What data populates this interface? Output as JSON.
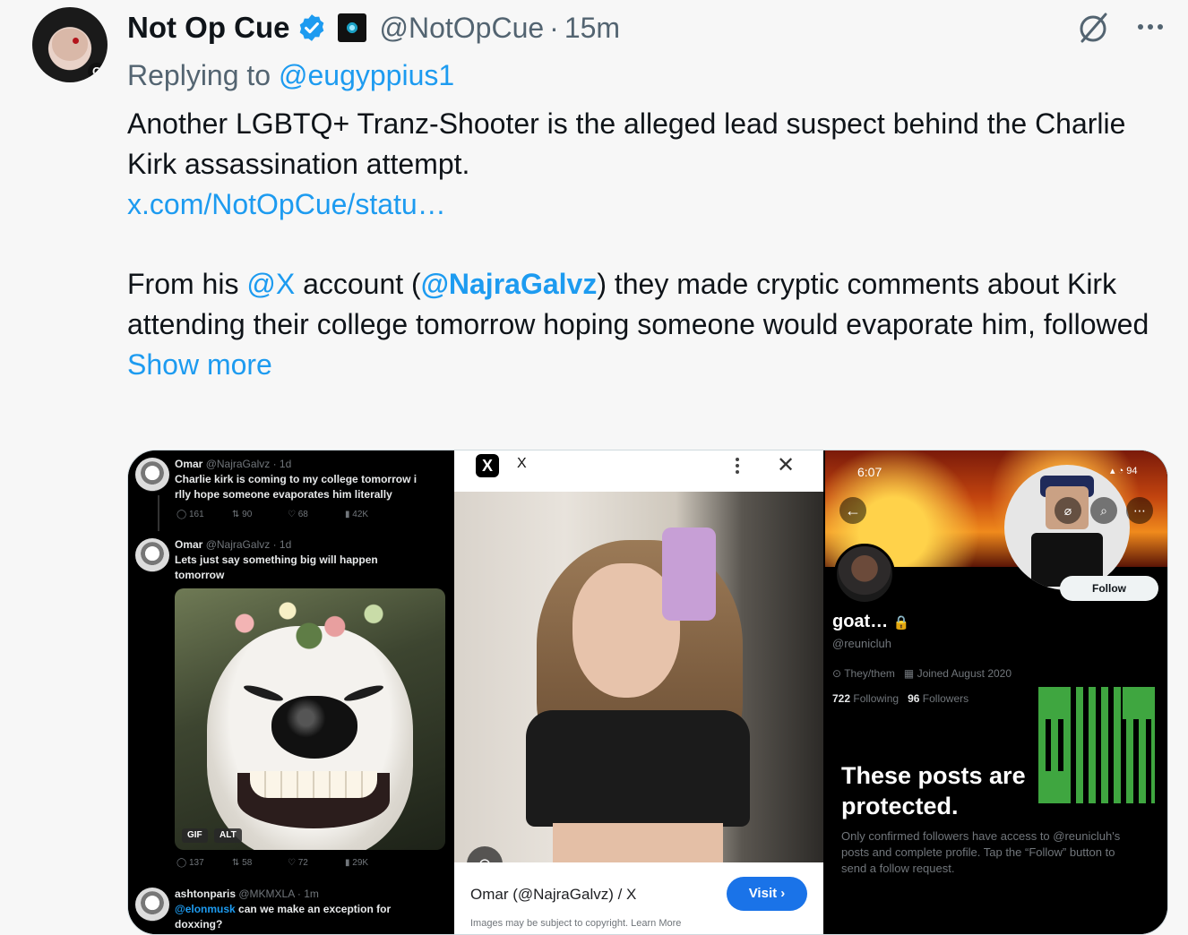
{
  "tweet": {
    "author_name": "Not Op Cue",
    "handle": "@NotOpCue",
    "separator": "·",
    "time": "15m",
    "replying_prefix": "Replying to",
    "replying_to": "@eugyppius1",
    "line1": "Another LGBTQ+ Tranz-Shooter is the alleged lead suspect behind the Charlie Kirk assassination attempt.",
    "link": "x.com/NotOpCue/statu…",
    "p2_a": "From his ",
    "p2_mention1": "@X",
    "p2_b": " account (",
    "p2_mention2": "@NajraGalvz",
    "p2_c": ") they made cryptic comments about Kirk attending their college tomorrow hoping someone would evaporate him, followed",
    "show_more": "Show more"
  },
  "panel1": {
    "post1": {
      "name": "Omar",
      "meta": "@NajraGalvz · 1d",
      "line1": "Charlie kirk is coming to my college tomorrow i",
      "line2": "rlly hope someone evaporates him literally",
      "replies": "161",
      "reposts": "90",
      "likes": "68",
      "views": "42K"
    },
    "post2": {
      "name": "Omar",
      "meta": "@NajraGalvz · 1d",
      "line1": "Lets just say something big will happen",
      "line2": "tomorrow",
      "gif": "GIF",
      "alt": "ALT",
      "replies": "137",
      "reposts": "58",
      "likes": "72",
      "views": "29K"
    },
    "post3": {
      "name": "ashtonparis",
      "meta": "@MKMXLA · 1m",
      "mention": "@elonmusk",
      "line1": " can we make an exception for",
      "line2": "doxxing?"
    }
  },
  "panel2": {
    "brand": "X",
    "title": "Omar (@NajraGalvz) / X",
    "visit": "Visit ›",
    "copyright": "Images may be subject to copyright. Learn More"
  },
  "panel3": {
    "clock": "6:07",
    "status": "94",
    "name": "goat…",
    "handle": "@reunicluh",
    "pronouns": "They/them",
    "joined": "Joined August 2020",
    "following_count": "722",
    "following_label": " Following",
    "followers_count": "96",
    "followers_label": " Followers",
    "follow": "Follow",
    "protected_l1": "These posts are",
    "protected_l2": "protected.",
    "protected_desc": "Only confirmed followers have access to @reunicluh's posts and complete profile. Tap the “Follow” button to send a follow request."
  },
  "colors": {
    "link": "#1d9bf0",
    "muted": "#536471",
    "visit": "#1a73e8"
  }
}
